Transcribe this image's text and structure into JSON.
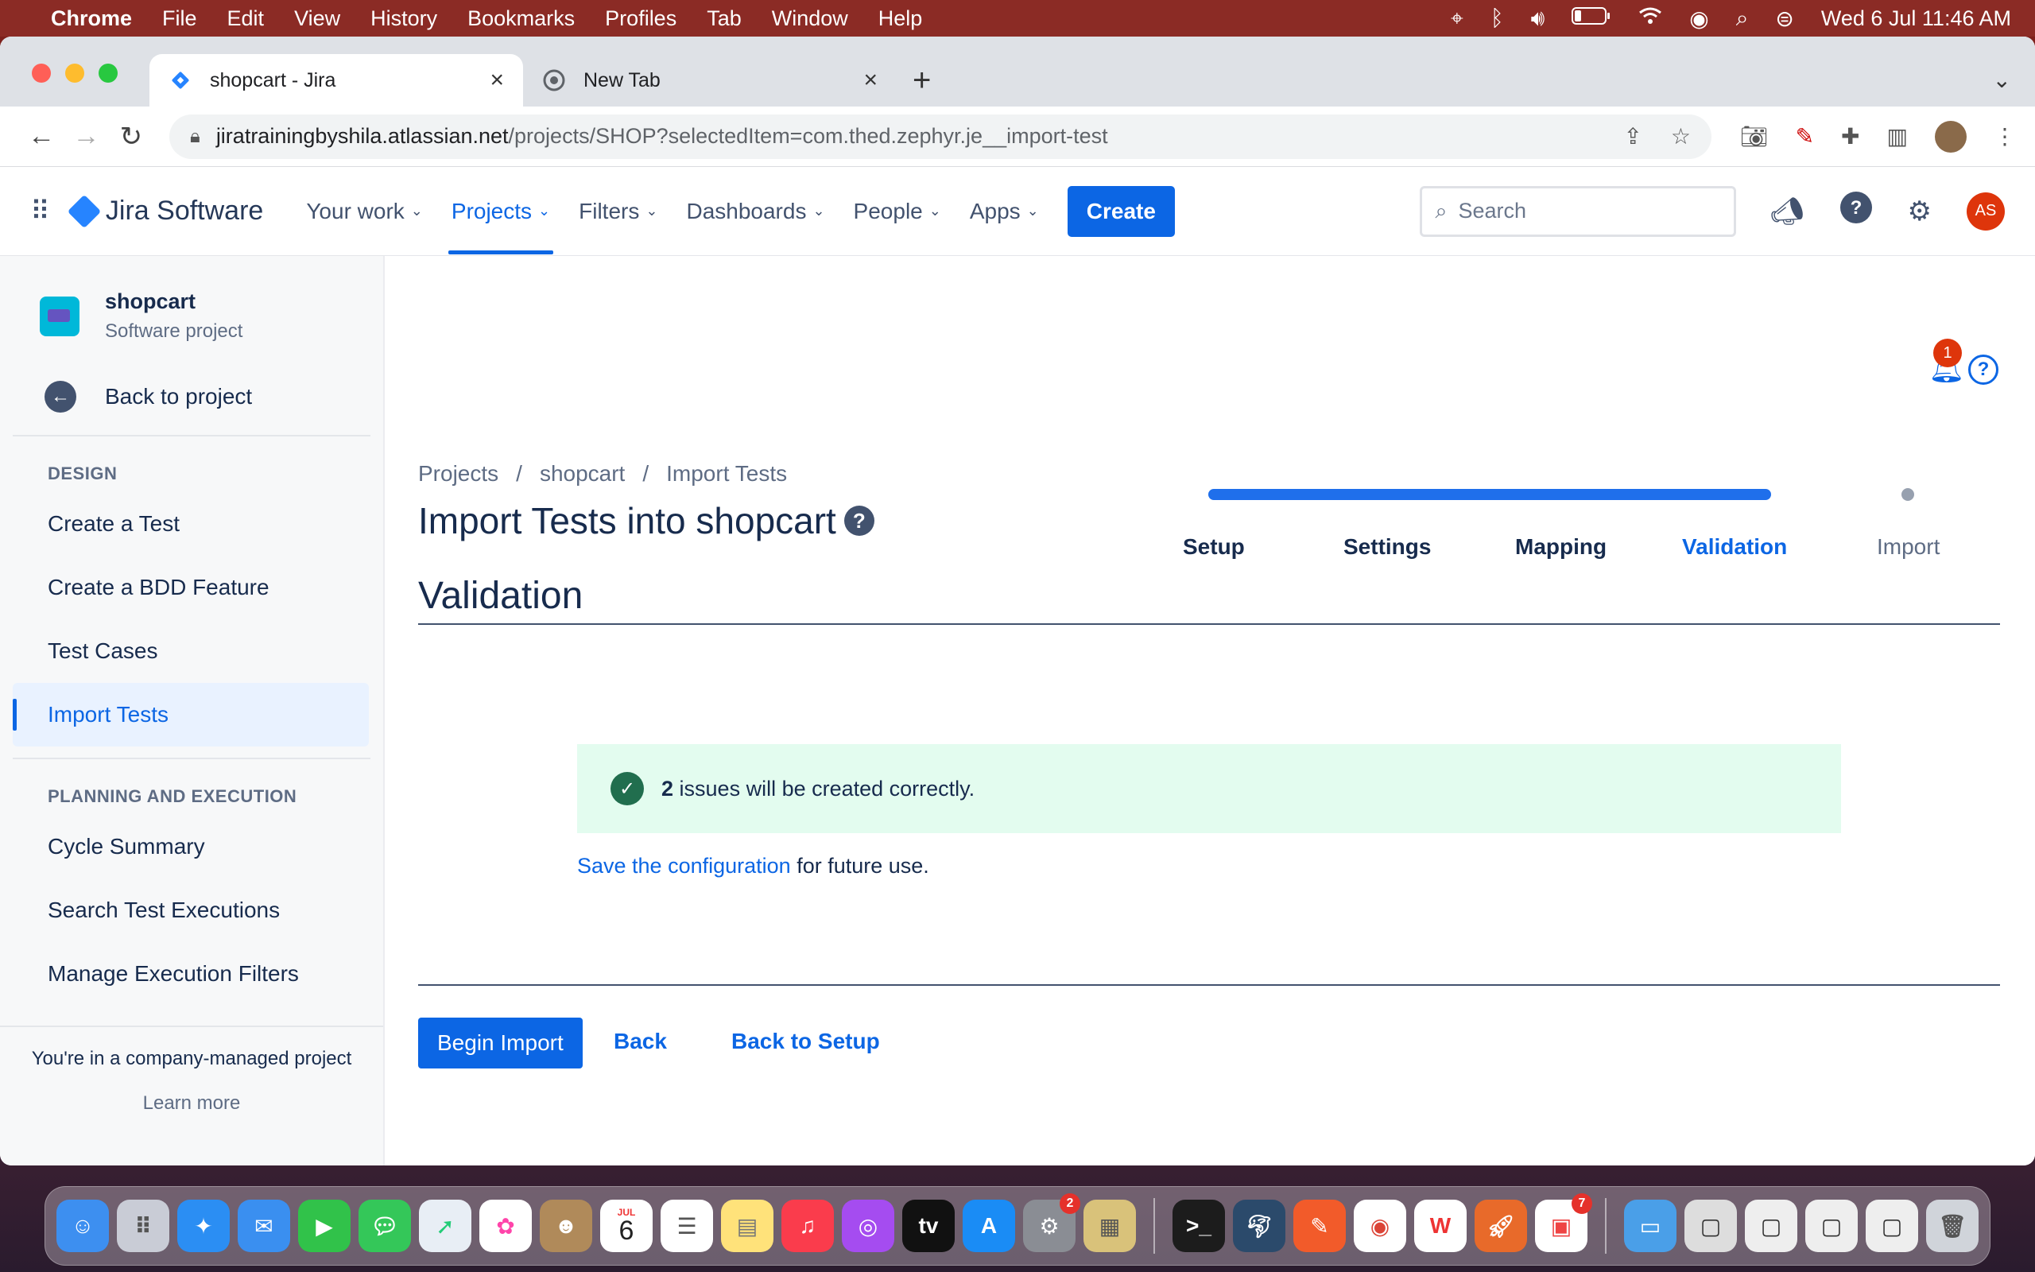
{
  "menubar": {
    "app": "Chrome",
    "items": [
      "File",
      "Edit",
      "View",
      "History",
      "Bookmarks",
      "Profiles",
      "Tab",
      "Window",
      "Help"
    ],
    "clock": "Wed 6 Jul  11:46 AM"
  },
  "browser": {
    "tabs": [
      {
        "title": "shopcart - Jira"
      },
      {
        "title": "New Tab"
      }
    ],
    "url_host": "jiratrainingbyshila.atlassian.net",
    "url_path": "/projects/SHOP?selectedItem=com.thed.zephyr.je__import-test"
  },
  "jira_nav": {
    "product": "Jira Software",
    "items": [
      "Your work",
      "Projects",
      "Filters",
      "Dashboards",
      "People",
      "Apps"
    ],
    "create_label": "Create",
    "search_placeholder": "Search",
    "user_initials": "AS"
  },
  "sidebar": {
    "project_name": "shopcart",
    "project_type": "Software project",
    "back_label": "Back to project",
    "design_header": "DESIGN",
    "design_items": [
      "Create a Test",
      "Create a BDD Feature",
      "Test Cases",
      "Import Tests"
    ],
    "planning_header": "PLANNING AND EXECUTION",
    "planning_items": [
      "Cycle Summary",
      "Search Test Executions",
      "Manage Execution Filters"
    ],
    "footer_text": "You're in a company-managed project",
    "footer_link": "Learn more"
  },
  "main": {
    "notification_count": "1",
    "breadcrumb": [
      "Projects",
      "shopcart",
      "Import Tests"
    ],
    "title": "Import Tests into shopcart",
    "steps": [
      "Setup",
      "Settings",
      "Mapping",
      "Validation",
      "Import"
    ],
    "section_title": "Validation",
    "success_count": "2",
    "success_text": "issues will be created correctly.",
    "save_link": "Save the configuration",
    "save_suffix": "for future use.",
    "begin_label": "Begin Import",
    "back_label": "Back",
    "back_setup_label": "Back to Setup"
  },
  "dock": {
    "calendar_month": "JUL",
    "calendar_day": "6",
    "badge_settings": "2",
    "badge_office": "7"
  },
  "colors": {
    "accent": "#0c66e4",
    "success_bg": "#e3fcef",
    "success_icon": "#216e4e"
  }
}
